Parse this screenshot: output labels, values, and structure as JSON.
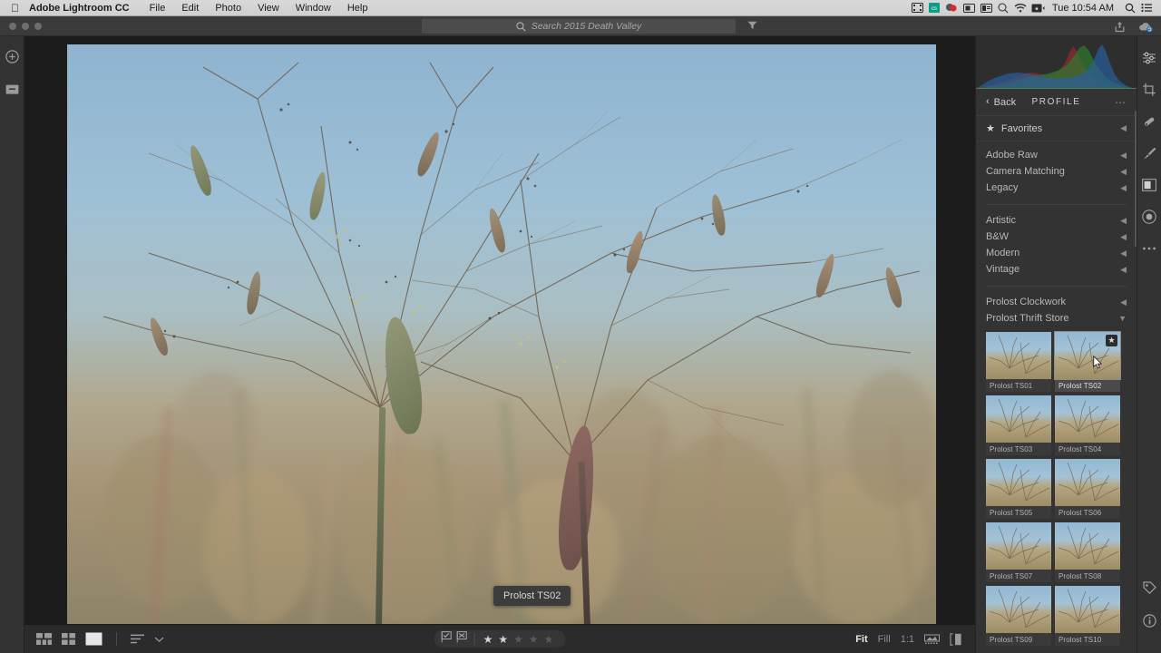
{
  "menubar": {
    "apple": "apple-logo",
    "app_name": "Adobe Lightroom CC",
    "items": [
      "File",
      "Edit",
      "Photo",
      "View",
      "Window",
      "Help"
    ],
    "status_icons": [
      "screen-recording-icon",
      "dropbox-icon",
      "color-wheel-icon",
      "display-icon",
      "battery-meter-icon",
      "spotlight-mini-icon",
      "wifi-icon",
      "keyboard-input-icon"
    ],
    "clock": "Tue 10:54 AM",
    "right_icons": [
      "search-icon",
      "control-center-icon"
    ]
  },
  "titlebar": {
    "traffic_lights": [
      "close",
      "minimize",
      "maximize"
    ],
    "search_placeholder": "Search 2015 Death Valley",
    "search_icon": "search-icon",
    "filter_icon": "filter-icon",
    "share_icon": "share-icon",
    "sync_icon": "cloud-sync-icon"
  },
  "left_rail": {
    "icons": [
      "add-photos-icon",
      "library-icon"
    ]
  },
  "right_rail": {
    "icons": [
      "edit-sliders-icon",
      "crop-icon",
      "healing-brush-icon",
      "brush-icon",
      "linear-gradient-icon",
      "radial-gradient-icon",
      "more-options-icon"
    ],
    "bottom_icons": [
      "keywords-tag-icon",
      "info-icon"
    ]
  },
  "panel": {
    "back_label": "Back",
    "back_icon": "chevron-left-icon",
    "title": "PROFILE",
    "more_icon": "more-options-icon",
    "favorites": {
      "label": "Favorites",
      "star_icon": "star-icon",
      "chevron": "chevron-left-icon"
    },
    "groups_primary": [
      {
        "label": "Adobe Raw",
        "chevron": "chevron-left-icon",
        "expanded": false
      },
      {
        "label": "Camera Matching",
        "chevron": "chevron-left-icon",
        "expanded": false
      },
      {
        "label": "Legacy",
        "chevron": "chevron-left-icon",
        "expanded": false
      }
    ],
    "groups_secondary": [
      {
        "label": "Artistic",
        "chevron": "chevron-left-icon",
        "expanded": false
      },
      {
        "label": "B&W",
        "chevron": "chevron-left-icon",
        "expanded": false
      },
      {
        "label": "Modern",
        "chevron": "chevron-left-icon",
        "expanded": false
      },
      {
        "label": "Vintage",
        "chevron": "chevron-left-icon",
        "expanded": false
      }
    ],
    "groups_custom": [
      {
        "label": "Prolost Clockwork",
        "chevron": "chevron-left-icon",
        "expanded": false
      },
      {
        "label": "Prolost Thrift Store",
        "chevron": "chevron-down-icon",
        "expanded": true
      }
    ],
    "profiles": [
      {
        "name": "Prolost TS01",
        "selected": false,
        "favorited": false
      },
      {
        "name": "Prolost TS02",
        "selected": true,
        "favorited": true
      },
      {
        "name": "Prolost TS03",
        "selected": false,
        "favorited": false
      },
      {
        "name": "Prolost TS04",
        "selected": false,
        "favorited": false
      },
      {
        "name": "Prolost TS05",
        "selected": false,
        "favorited": false
      },
      {
        "name": "Prolost TS06",
        "selected": false,
        "favorited": false
      },
      {
        "name": "Prolost TS07",
        "selected": false,
        "favorited": false
      },
      {
        "name": "Prolost TS08",
        "selected": false,
        "favorited": false
      },
      {
        "name": "Prolost TS09",
        "selected": false,
        "favorited": false
      },
      {
        "name": "Prolost TS10",
        "selected": false,
        "favorited": false
      }
    ]
  },
  "canvas": {
    "tooltip": "Prolost TS02"
  },
  "bottombar": {
    "view_icons": [
      "detail-grid-icon",
      "grid-icon",
      "single-photo-icon"
    ],
    "sort_icon": "sort-icon",
    "sort_chevron": "chevron-down-icon",
    "flags": [
      "flag-pick-icon",
      "flag-reject-icon"
    ],
    "rating": 2,
    "rating_max": 5,
    "zoom_levels": [
      {
        "label": "Fit",
        "active": true
      },
      {
        "label": "Fill",
        "active": false
      },
      {
        "label": "1:1",
        "active": false
      }
    ],
    "right_icons": [
      "filmstrip-icon",
      "before-after-icon"
    ]
  },
  "colors": {
    "panel_bg": "#333333",
    "canvas_bg": "#1c1c1c",
    "accent_text": "#e8e8e8",
    "muted_text": "#8e8e8e"
  }
}
